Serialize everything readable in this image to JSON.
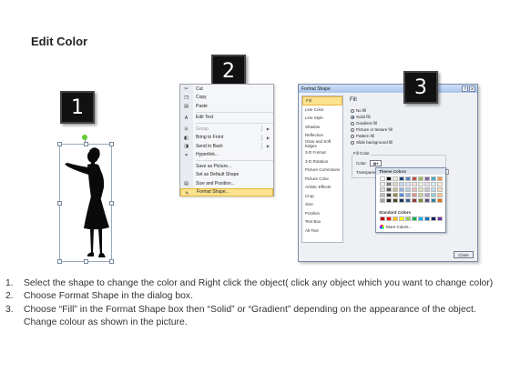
{
  "title": "Edit Color",
  "step_numbers": [
    "1",
    "2",
    "3"
  ],
  "context_menu": {
    "items": [
      {
        "label": "Cut",
        "icon": "scissors-icon",
        "glyph": "✂",
        "disabled": false
      },
      {
        "label": "Copy",
        "icon": "copy-icon",
        "glyph": "❐",
        "disabled": false
      },
      {
        "label": "Paste",
        "icon": "paste-icon",
        "glyph": "📋",
        "disabled": false
      },
      {
        "label": "Edit Text",
        "icon": "edit-text-icon",
        "glyph": "A",
        "disabled": false
      },
      {
        "label": "Group",
        "icon": "group-icon",
        "glyph": "▣",
        "disabled": true,
        "submenu": true
      },
      {
        "label": "Bring to Front",
        "icon": "bring-front-icon",
        "glyph": "◧",
        "disabled": false,
        "submenu": true
      },
      {
        "label": "Send to Back",
        "icon": "send-back-icon",
        "glyph": "◨",
        "disabled": false,
        "submenu": true
      },
      {
        "label": "Hyperlink...",
        "icon": "hyperlink-icon",
        "glyph": "⚭",
        "disabled": false
      },
      {
        "label": "Save as Picture...",
        "icon": "",
        "glyph": "",
        "disabled": false
      },
      {
        "label": "Set as Default Shape",
        "icon": "",
        "glyph": "",
        "disabled": false
      },
      {
        "label": "Size and Position...",
        "icon": "size-position-icon",
        "glyph": "▤",
        "disabled": false
      },
      {
        "label": "Format Shape...",
        "icon": "format-shape-icon",
        "glyph": "✎",
        "disabled": false,
        "highlighted": true
      }
    ]
  },
  "dialog": {
    "title": "Format Shape",
    "help": "?",
    "close_x": "X",
    "categories": [
      "Fill",
      "Line Color",
      "Line Style",
      "Shadow",
      "Reflection",
      "Glow and Soft Edges",
      "3-D Format",
      "3-D Rotation",
      "Picture Corrections",
      "Picture Color",
      "Artistic Effects",
      "Crop",
      "Size",
      "Position",
      "Text Box",
      "Alt Text"
    ],
    "selected_category": "Fill",
    "fill_heading": "Fill",
    "fill_options": [
      {
        "label": "No fill",
        "selected": false
      },
      {
        "label": "Solid fill",
        "selected": true
      },
      {
        "label": "Gradient fill",
        "selected": false
      },
      {
        "label": "Picture or texture fill",
        "selected": false
      },
      {
        "label": "Pattern fill",
        "selected": false
      },
      {
        "label": "Slide background fill",
        "selected": false
      }
    ],
    "fill_color_group": "Fill Color",
    "color_label": "Color:",
    "transparency_label": "Transparency:",
    "close_button": "Close"
  },
  "palette": {
    "theme_heading": "Theme Colors",
    "theme_colors": [
      "#ffffff",
      "#000000",
      "#eeece1",
      "#1f497d",
      "#4f81bd",
      "#c0504d",
      "#9bbb59",
      "#8064a2",
      "#4bacc6",
      "#f79646",
      "#f2f2f2",
      "#7f7f7f",
      "#ddd9c3",
      "#c6d9f0",
      "#dbe5f1",
      "#f2dcdb",
      "#ebf1dd",
      "#e5e0ec",
      "#dbeef3",
      "#fdeada",
      "#d8d8d8",
      "#595959",
      "#c4bd97",
      "#8db3e2",
      "#b8cce4",
      "#e5b9b7",
      "#d7e3bc",
      "#ccc1d9",
      "#b7dde8",
      "#fbd5b5",
      "#bfbfbf",
      "#3f3f3f",
      "#938953",
      "#548dd4",
      "#95b3d7",
      "#d99694",
      "#c3d69b",
      "#b2a2c7",
      "#92cddc",
      "#fac08f",
      "#a5a5a5",
      "#262626",
      "#494429",
      "#17365d",
      "#366092",
      "#953734",
      "#76923c",
      "#5f497a",
      "#31859b",
      "#e36c09"
    ],
    "standard_heading": "Standard Colors",
    "standard_colors": [
      "#c00000",
      "#ff0000",
      "#ffc000",
      "#ffff00",
      "#92d050",
      "#00b050",
      "#00b0f0",
      "#0070c0",
      "#002060",
      "#7030a0"
    ],
    "more_colors": "More Colors..."
  },
  "instructions": [
    {
      "num": "1.",
      "text": "Select the shape to change the color and Right click the object( click any object which you want to change color)"
    },
    {
      "num": "2.",
      "text": "Choose Format Shape in the dialog box."
    },
    {
      "num": "3.",
      "text": "Choose “Fill” in the Format Shape box then “Solid” or “Gradient” depending on the appearance of the object. Change colour as shown in the picture."
    }
  ]
}
